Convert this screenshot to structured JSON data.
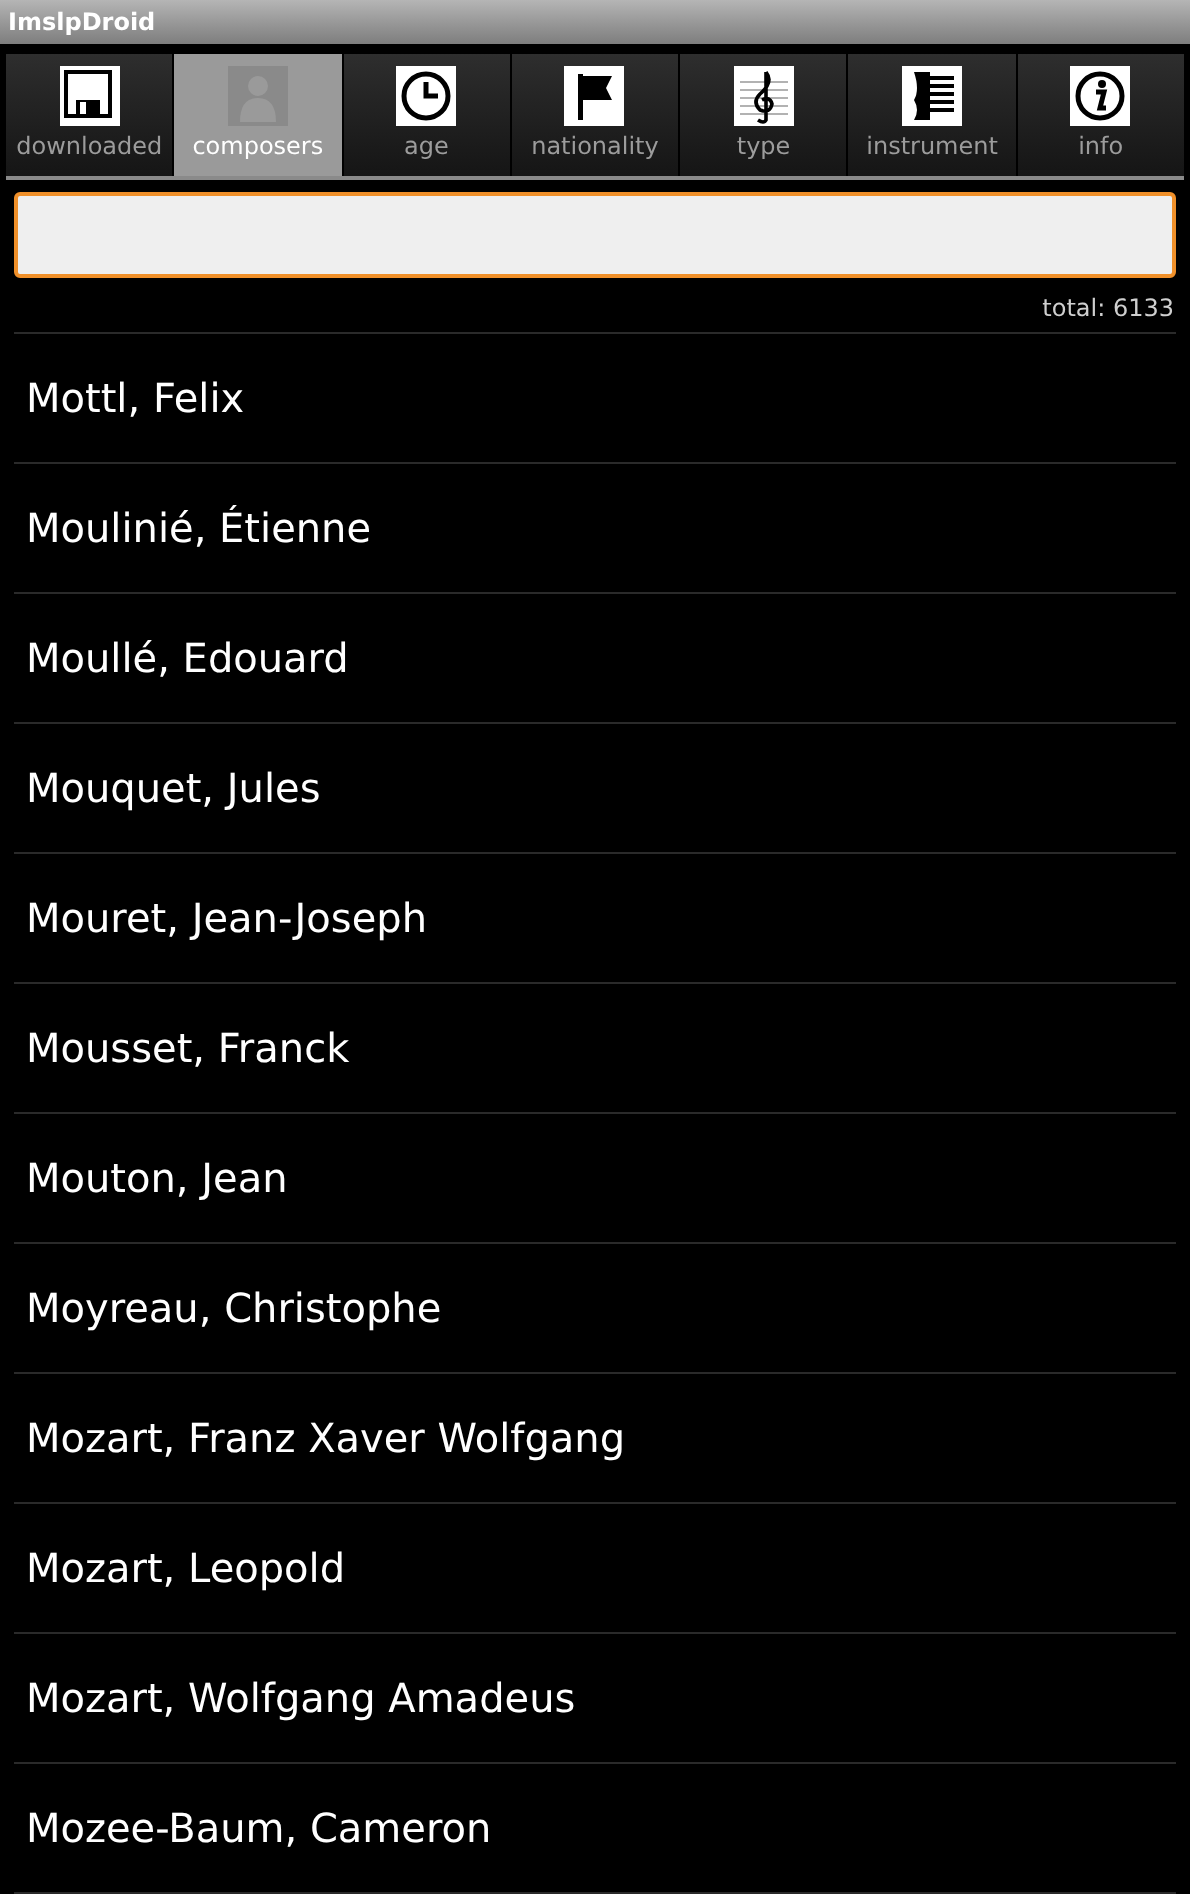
{
  "window": {
    "title": "ImslpDroid"
  },
  "tabs": [
    {
      "label": "downloaded",
      "kind": "floppy",
      "selected": false
    },
    {
      "label": "composers",
      "kind": "person",
      "selected": true
    },
    {
      "label": "age",
      "kind": "clock",
      "selected": false
    },
    {
      "label": "nationality",
      "kind": "flag",
      "selected": false
    },
    {
      "label": "type",
      "kind": "clef",
      "selected": false
    },
    {
      "label": "instrument",
      "kind": "piano",
      "selected": false
    },
    {
      "label": "info",
      "kind": "info",
      "selected": false
    }
  ],
  "total": "total: 6133",
  "composers": [
    "Mottl, Felix",
    "Moulinié, Étienne",
    "Moullé, Edouard",
    "Mouquet, Jules",
    "Mouret, Jean-Joseph",
    "Mousset, Franck",
    "Mouton, Jean",
    "Moyreau, Christophe",
    "Mozart, Franz Xaver Wolfgang",
    "Mozart, Leopold",
    "Mozart, Wolfgang Amadeus",
    "Mozee-Baum, Cameron"
  ]
}
